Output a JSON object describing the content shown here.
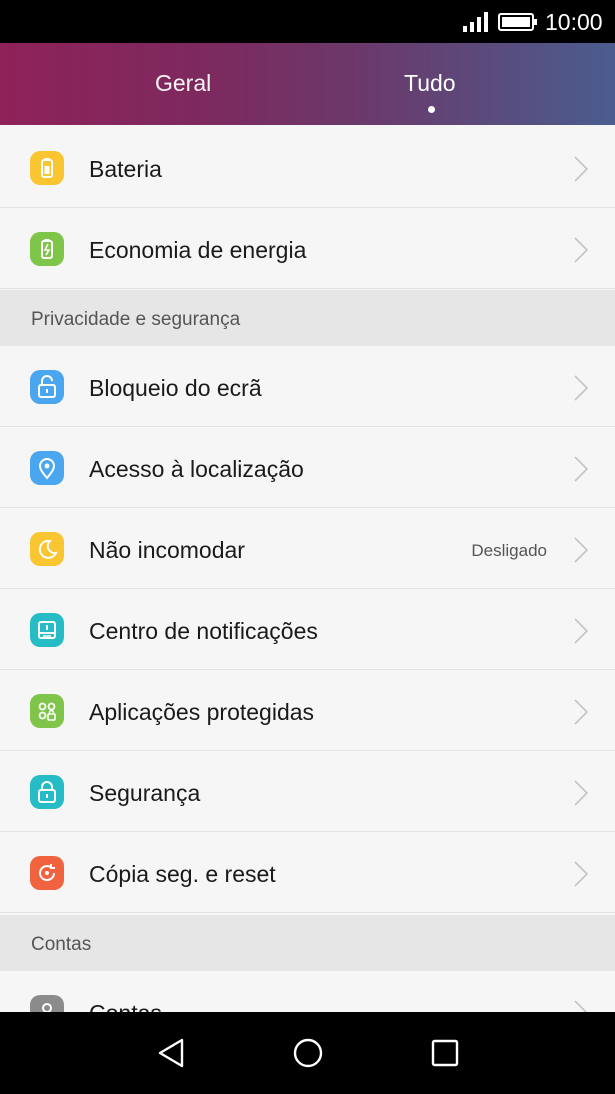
{
  "status_bar": {
    "time": "10:00",
    "signal_icon": "signal-icon",
    "battery_icon": "battery-icon"
  },
  "tabs": [
    {
      "label": "Geral",
      "selected": false
    },
    {
      "label": "Tudo",
      "selected": true
    }
  ],
  "rows": {
    "bateria": {
      "label": "Bateria",
      "icon": "battery-icon",
      "color": "#f9c531"
    },
    "economia": {
      "label": "Economia de energia",
      "icon": "power-saving-icon",
      "color": "#7ec549"
    },
    "bloqueio": {
      "label": "Bloqueio do ecrã",
      "icon": "unlock-icon",
      "color": "#4aa6ef"
    },
    "localizacao": {
      "label": "Acesso à localização",
      "icon": "location-icon",
      "color": "#4aa6ef"
    },
    "nao_incomodar": {
      "label": "Não incomodar",
      "value": "Desligado",
      "icon": "moon-icon",
      "color": "#f9c531"
    },
    "notificacoes": {
      "label": "Centro de notificações",
      "icon": "notification-center-icon",
      "color": "#25bcc6"
    },
    "aplicacoes": {
      "label": "Aplicações protegidas",
      "icon": "protected-apps-icon",
      "color": "#7ec549"
    },
    "seguranca": {
      "label": "Segurança",
      "icon": "lock-icon",
      "color": "#25bcc6"
    },
    "copia": {
      "label": "Cópia seg. e reset",
      "icon": "backup-icon",
      "color": "#f1623f"
    },
    "contas": {
      "label": "Contas",
      "icon": "account-icon",
      "color": "#8b8b8b"
    }
  },
  "sections": {
    "privacidade": "Privacidade e segurança",
    "contas": "Contas"
  },
  "nav_bar": {
    "back_icon": "back-icon",
    "home_icon": "home-icon",
    "recent_icon": "recent-apps-icon"
  }
}
